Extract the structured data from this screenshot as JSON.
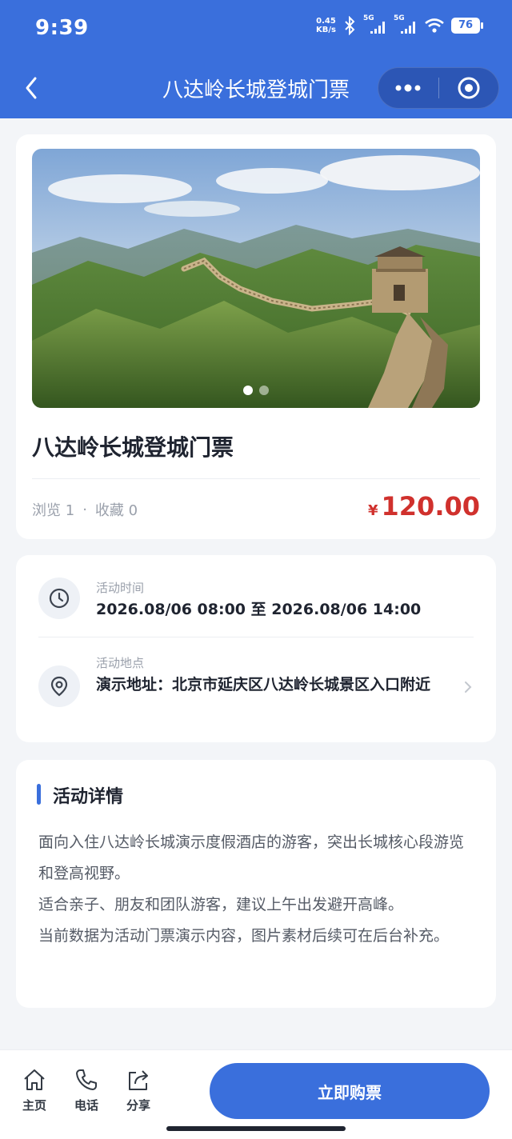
{
  "status_bar": {
    "time": "9:39",
    "net_speed": "0.45",
    "net_unit": "KB/s",
    "sig1": "5G",
    "sig2": "5G",
    "battery": "76"
  },
  "nav": {
    "title": "八达岭长城登城门票"
  },
  "product": {
    "title": "八达岭长城登城门票",
    "views": "浏览 1",
    "sep": "·",
    "favorites": "收藏 0",
    "currency": "¥",
    "price": "120.00",
    "slides_total": 2,
    "slide_active": 1
  },
  "activity": {
    "time_label": "活动时间",
    "time_value": "2026.08/06 08:00 至 2026.08/06 14:00",
    "location_label": "活动地点",
    "location_value": "演示地址：北京市延庆区八达岭长城景区入口附近"
  },
  "details": {
    "title": "活动详情",
    "paragraphs": [
      "面向入住八达岭长城演示度假酒店的游客，突出长城核心段游览和登高视野。",
      "适合亲子、朋友和团队游客，建议上午出发避开高峰。",
      "当前数据为活动门票演示内容，图片素材后续可在后台补充。"
    ]
  },
  "bottom_bar": {
    "home": "主页",
    "phone": "电话",
    "share": "分享",
    "buy": "立即购票"
  },
  "colors": {
    "primary": "#3a6fdc",
    "price": "#d0312d"
  },
  "icons": [
    "back-icon",
    "more-icon",
    "target-icon",
    "clock-icon",
    "location-pin-icon",
    "chevron-right-icon",
    "home-icon",
    "phone-icon",
    "share-icon"
  ]
}
